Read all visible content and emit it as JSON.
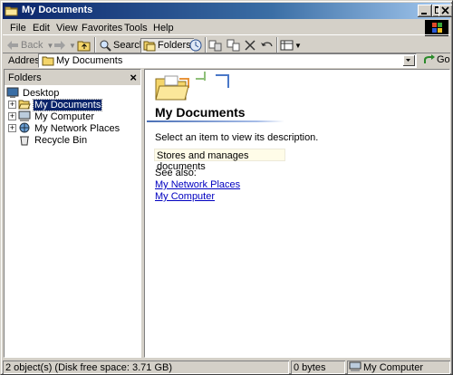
{
  "window": {
    "title": "My Documents"
  },
  "menu": {
    "items": [
      "File",
      "Edit",
      "View",
      "Favorites",
      "Tools",
      "Help"
    ]
  },
  "toolbar": {
    "back_label": "Back",
    "search_label": "Search",
    "folders_label": "Folders"
  },
  "address": {
    "label": "Address",
    "value": "My Documents",
    "go_label": "Go"
  },
  "folders_pane": {
    "title": "Folders",
    "close_glyph": "×",
    "tree": [
      {
        "label": "Desktop",
        "icon": "desktop-icon",
        "expander": ""
      },
      {
        "label": "My Documents",
        "icon": "folder-open-icon",
        "expander": "+",
        "selected": true
      },
      {
        "label": "My Computer",
        "icon": "computer-icon",
        "expander": "+"
      },
      {
        "label": "My Network Places",
        "icon": "network-icon",
        "expander": "+"
      },
      {
        "label": "Recycle Bin",
        "icon": "recycle-bin-icon",
        "expander": ""
      }
    ]
  },
  "content": {
    "title": "My Documents",
    "prompt": "Select an item to view its description.",
    "description": "Stores and manages documents",
    "see_also_label": "See also:",
    "links": [
      "My Network Places",
      "My Computer"
    ]
  },
  "status": {
    "objects": "2 object(s) (Disk free space: 3.71 GB)",
    "size": "0 bytes",
    "zone": "My Computer"
  },
  "colors": {
    "title_start": "#0a246a",
    "title_end": "#a6caf0",
    "selection": "#0a246a",
    "link": "#0000c0",
    "face": "#d4d0c8"
  }
}
